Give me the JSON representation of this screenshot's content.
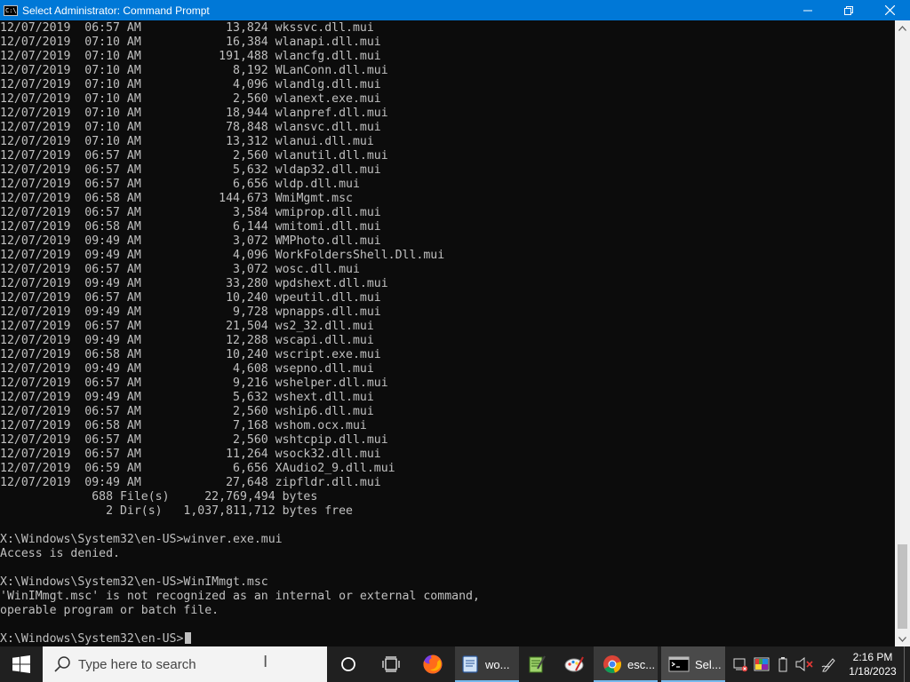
{
  "window": {
    "title": "Select Administrator: Command Prompt",
    "icon_text": "C:\\"
  },
  "console": {
    "lines": [
      "12/07/2019  06:57 AM            13,824 wkssvc.dll.mui",
      "12/07/2019  07:10 AM            16,384 wlanapi.dll.mui",
      "12/07/2019  07:10 AM           191,488 wlancfg.dll.mui",
      "12/07/2019  07:10 AM             8,192 WLanConn.dll.mui",
      "12/07/2019  07:10 AM             4,096 wlandlg.dll.mui",
      "12/07/2019  07:10 AM             2,560 wlanext.exe.mui",
      "12/07/2019  07:10 AM            18,944 wlanpref.dll.mui",
      "12/07/2019  07:10 AM            78,848 wlansvc.dll.mui",
      "12/07/2019  07:10 AM            13,312 wlanui.dll.mui",
      "12/07/2019  06:57 AM             2,560 wlanutil.dll.mui",
      "12/07/2019  06:57 AM             5,632 wldap32.dll.mui",
      "12/07/2019  06:57 AM             6,656 wldp.dll.mui",
      "12/07/2019  06:58 AM           144,673 WmiMgmt.msc",
      "12/07/2019  06:57 AM             3,584 wmiprop.dll.mui",
      "12/07/2019  06:58 AM             6,144 wmitomi.dll.mui",
      "12/07/2019  09:49 AM             3,072 WMPhoto.dll.mui",
      "12/07/2019  09:49 AM             4,096 WorkFoldersShell.Dll.mui",
      "12/07/2019  06:57 AM             3,072 wosc.dll.mui",
      "12/07/2019  09:49 AM            33,280 wpdshext.dll.mui",
      "12/07/2019  06:57 AM            10,240 wpeutil.dll.mui",
      "12/07/2019  09:49 AM             9,728 wpnapps.dll.mui",
      "12/07/2019  06:57 AM            21,504 ws2_32.dll.mui",
      "12/07/2019  09:49 AM            12,288 wscapi.dll.mui",
      "12/07/2019  06:58 AM            10,240 wscript.exe.mui",
      "12/07/2019  09:49 AM             4,608 wsepno.dll.mui",
      "12/07/2019  06:57 AM             9,216 wshelper.dll.mui",
      "12/07/2019  09:49 AM             5,632 wshext.dll.mui",
      "12/07/2019  06:57 AM             2,560 wship6.dll.mui",
      "12/07/2019  06:58 AM             7,168 wshom.ocx.mui",
      "12/07/2019  06:57 AM             2,560 wshtcpip.dll.mui",
      "12/07/2019  06:57 AM            11,264 wsock32.dll.mui",
      "12/07/2019  06:59 AM             6,656 XAudio2_9.dll.mui",
      "12/07/2019  09:49 AM            27,648 zipfldr.dll.mui",
      "             688 File(s)     22,769,494 bytes",
      "               2 Dir(s)   1,037,811,712 bytes free",
      "",
      "X:\\Windows\\System32\\en-US>winver.exe.mui",
      "Access is denied.",
      "",
      "X:\\Windows\\System32\\en-US>WinIMmgt.msc",
      "'WinIMmgt.msc' is not recognized as an internal or external command,",
      "operable program or batch file.",
      ""
    ],
    "prompt": "X:\\Windows\\System32\\en-US>"
  },
  "taskbar": {
    "search_placeholder": "Type here to search",
    "apps": [
      {
        "name": "word",
        "label": "wo..."
      },
      {
        "name": "chrome",
        "label": "esc..."
      },
      {
        "name": "cmd",
        "label": "Sel..."
      }
    ],
    "clock": {
      "time": "2:16 PM",
      "date": "1/18/2023"
    }
  },
  "colors": {
    "titlebar": "#0078d7",
    "console_bg": "#0c0c0c",
    "console_text": "#c0c0c0",
    "taskbar_bg": "#202020",
    "accent_underline": "#76b9ed"
  },
  "icons": {
    "start": "windows-logo-icon",
    "search": "search-icon",
    "task_view": "task-view-icon",
    "cortana": "cortana-circle-icon",
    "firefox": "firefox-icon",
    "notepad": "notepad-icon",
    "paint": "paint-icon",
    "chrome": "chrome-icon",
    "cmd": "cmd-icon",
    "tray": [
      "network-tools-icon",
      "color-palette-icon",
      "battery-icon",
      "volume-muted-icon",
      "pen-icon"
    ]
  }
}
